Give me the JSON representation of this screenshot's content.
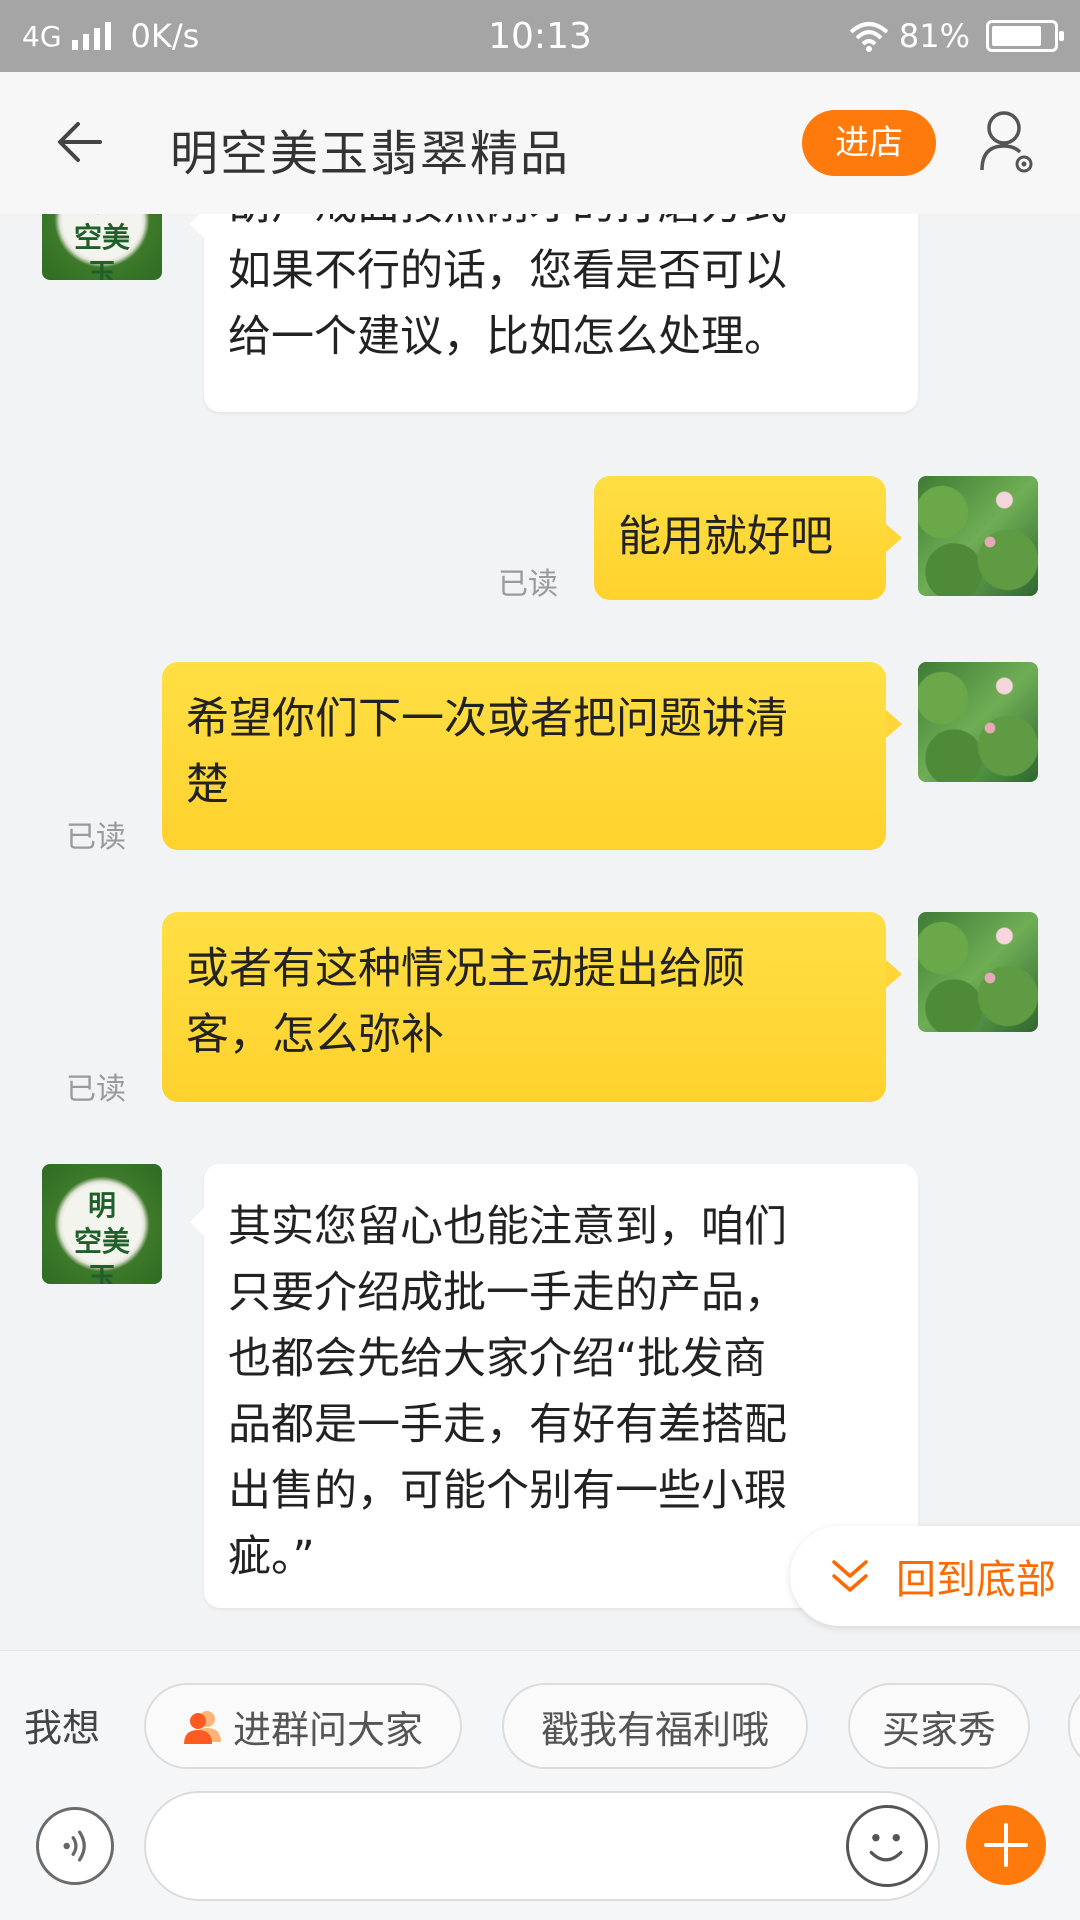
{
  "status_bar": {
    "network": "4G",
    "speed": "0K/s",
    "time": "10:13",
    "battery": "81%",
    "battery_level": 0.81
  },
  "header": {
    "title": "明空美玉翡翠精品",
    "shop_button": "进店"
  },
  "shop_avatar_text": [
    "明",
    "空美",
    "玉"
  ],
  "messages": [
    {
      "from": "shop",
      "lines": [
        "葫芦戒面按照刚才的打磨方式",
        "如果不行的话，您看是否可以",
        "给一个建议，比如怎么处理。"
      ]
    },
    {
      "from": "me",
      "lines": [
        "能用就好吧"
      ],
      "status": "已读"
    },
    {
      "from": "me",
      "lines": [
        "希望你们下一次或者把问题讲清",
        "楚"
      ],
      "status": "已读"
    },
    {
      "from": "me",
      "lines": [
        "或者有这种情况主动提出给顾",
        "客，怎么弥补"
      ],
      "status": "已读"
    },
    {
      "from": "shop",
      "lines": [
        "其实您留心也能注意到，咱们",
        "只要介绍成批一手走的产品，",
        "也都会先给大家介绍“批发商",
        "品都是一手走，有好有差搭配",
        "出售的，可能个别有一些小瑕",
        "疵。”"
      ]
    }
  ],
  "back_to_bottom": "回到底部",
  "quick_bar": {
    "label": "我想",
    "chips": [
      "进群问大家",
      "戳我有福利哦",
      "买家秀"
    ]
  },
  "input": {
    "placeholder": ""
  },
  "colors": {
    "accent": "#ff7a0d",
    "my_bubble": "#ffd63a",
    "shop_bubble": "#ffffff"
  }
}
